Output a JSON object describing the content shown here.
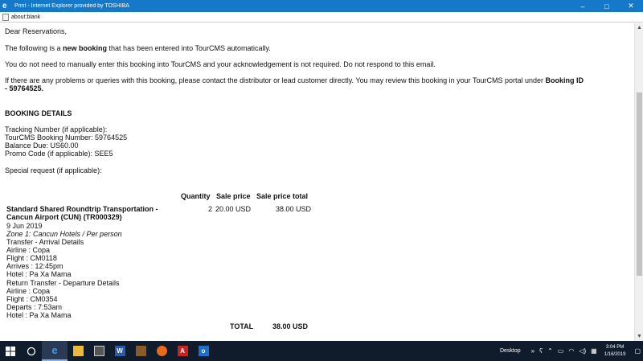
{
  "window": {
    "title": "Print - Internet Explorer provided by TOSHIBA",
    "address": "about:blank",
    "controls": {
      "minimize": "–",
      "maximize": "□",
      "close": "✕"
    }
  },
  "email": {
    "greeting": "Dear Reservations,",
    "intro_pre": "The following is a ",
    "intro_bold": "new booking",
    "intro_post": " that has been entered into TourCMS automatically.",
    "notice": "You do not need to manually enter this booking into TourCMS and your acknowledgement is not required. Do not respond to this email.",
    "problems_line1_pre": "If there are any problems or queries with this booking, please contact the distributor or lead customer directly. You may review this booking in your TourCMS portal under ",
    "problems_bold1": "Booking ID",
    "problems_bold2": "- 59764525.",
    "section_title": "BOOKING DETAILS",
    "tracking": "Tracking Number (if applicable):",
    "tourcms_number": "TourCMS Booking Number: 59764525",
    "balance_due": "Balance Due: US60.00",
    "promo": "Promo Code (if applicable): SEE5",
    "special_request": "Special request (if applicable):"
  },
  "table": {
    "headers": {
      "quantity": "Quantity",
      "sale_price": "Sale price",
      "sale_price_total": "Sale price total"
    },
    "item": {
      "name_line1": "Standard Shared Roundtrip Transportation -",
      "name_line2": "Cancun Airport (CUN) (TR000329)",
      "quantity": "2",
      "sale_price": "20.00 USD",
      "total": "38.00 USD",
      "details": [
        "9 Jun 2019",
        "Zone 1: Cancun Hotels / Per person",
        "Transfer - Arrival Details",
        "Airline : Copa",
        "Flight : CM0118",
        "Arrives : 12:45pm",
        "Hotel : Pa Xa Mama",
        "Return Transfer - Departure Details",
        "Airline : Copa",
        "Flight : CM0354",
        "Departs : 7:53am",
        "Hotel : Pa Xa Mama"
      ]
    },
    "total_label": "TOTAL",
    "total_value": "38.00 USD"
  },
  "taskbar": {
    "start_icon": "windows-logo",
    "search_icon": "circle",
    "apps": [
      "edge",
      "file-explorer",
      "calculator",
      "word",
      "app-brown",
      "firefox",
      "acrobat",
      "outlook"
    ],
    "desktop_label": "Desktop",
    "chevron": "»",
    "time": "3:04 PM",
    "date": "1/16/2019"
  },
  "colors": {
    "titlebar": "#1678c8",
    "taskbar": "#101b2c"
  }
}
